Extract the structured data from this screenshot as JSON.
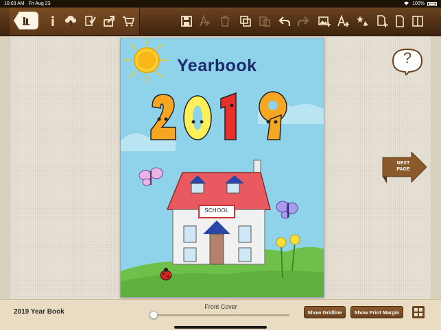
{
  "status_bar": {
    "time": "10:03 AM",
    "date": "Fri Aug 23",
    "battery": "100%"
  },
  "toolbar": {
    "left_icons": [
      "back-books-icon",
      "info-icon",
      "cloud-upload-icon",
      "checklist-icon",
      "share-icon",
      "cart-icon"
    ],
    "right_icons": [
      "save-icon",
      "font-size-icon",
      "trash-icon",
      "copy-icon",
      "paste-icon",
      "undo-icon",
      "redo-icon",
      "add-image-icon",
      "add-text-icon",
      "clipart-icon",
      "add-page-icon",
      "page-icon",
      "pages-icon"
    ],
    "accent_colors": [
      "#e8467c",
      "#f5c518",
      "#5ab34a"
    ]
  },
  "page": {
    "title": "Yearbook",
    "year": "2019",
    "building_sign": "SCHOOL"
  },
  "help": {
    "label": "?"
  },
  "next_page": {
    "line1": "NEXT",
    "line2": "PAGE"
  },
  "bottom": {
    "book_title": "2019 Year Book",
    "page_label": "Front Cover",
    "slider_value": 0,
    "show_gridline": "Show Gridline",
    "show_print_margin": "Show Print Margin"
  }
}
